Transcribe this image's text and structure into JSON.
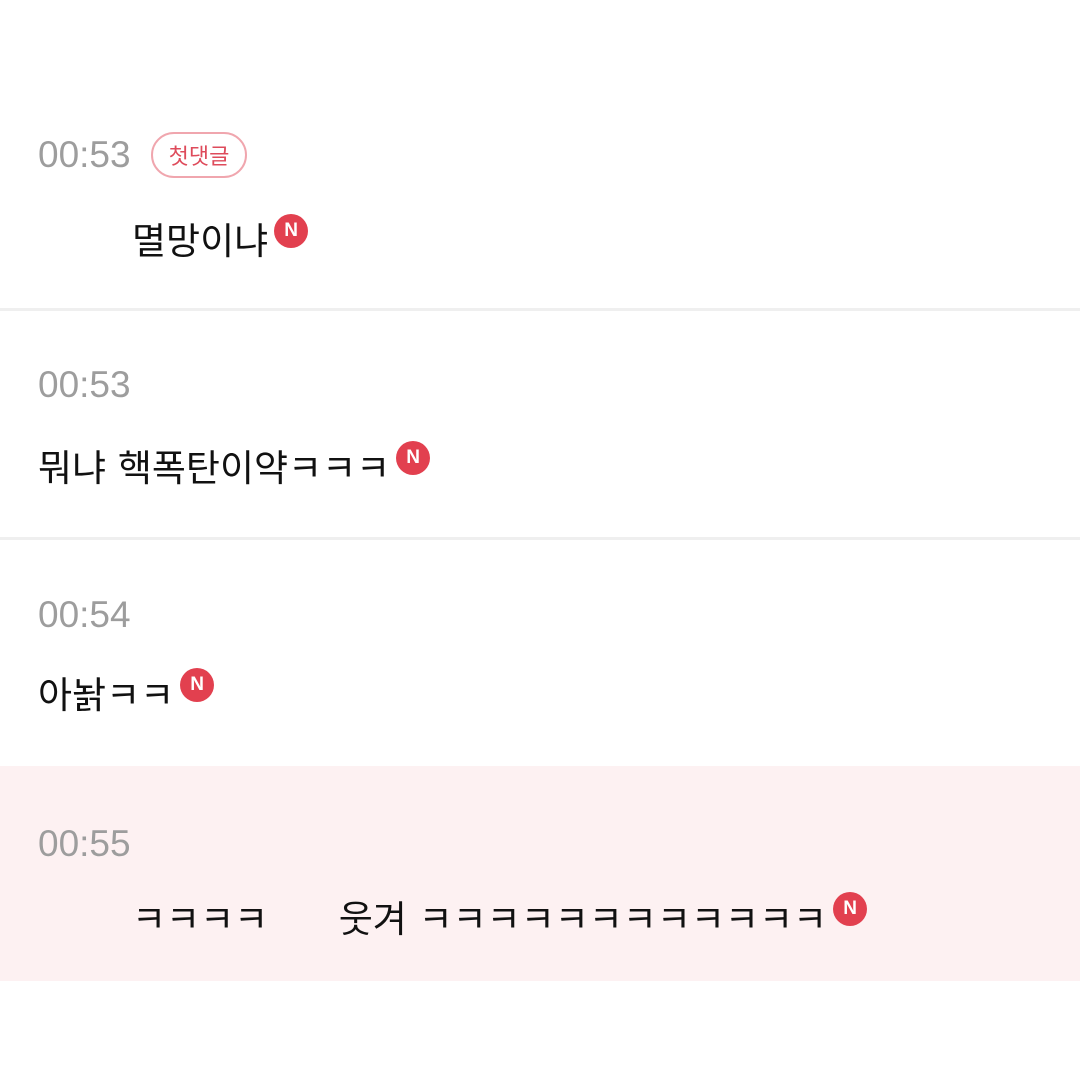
{
  "comments": [
    {
      "time": "00:53",
      "badge": "첫댓글",
      "text": "멸망이냐",
      "new_label": "N"
    },
    {
      "time": "00:53",
      "text": "뭐냐 핵폭탄이약ㅋㅋㅋ",
      "new_label": "N"
    },
    {
      "time": "00:54",
      "text": "아놝ㅋㅋ",
      "new_label": "N"
    },
    {
      "time": "00:55",
      "text": "ㅋㅋㅋㅋ      웃겨 ㅋㅋㅋㅋㅋㅋㅋㅋㅋㅋㅋㅋ",
      "new_label": "N",
      "highlighted": true,
      "highlight_color": "#fdf1f2"
    }
  ],
  "colors": {
    "time": "#9d9d9d",
    "badge_border": "#f0a6ae",
    "badge_text": "#de4b5b",
    "new_icon": "#e2404f",
    "divider": "#efefef"
  }
}
